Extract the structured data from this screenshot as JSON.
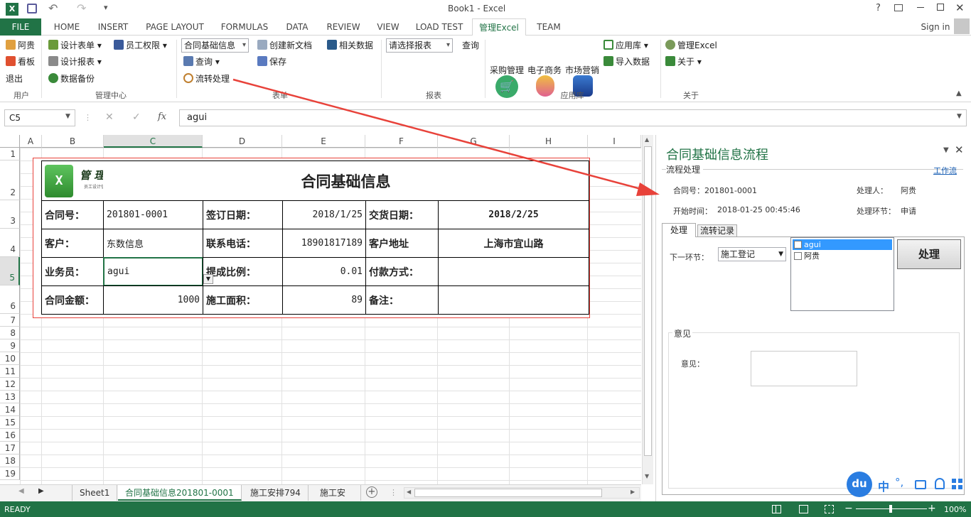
{
  "window": {
    "title": "Book1 - Excel",
    "help": "?",
    "signin": "Sign in"
  },
  "ribbon_tabs": [
    "FILE",
    "HOME",
    "INSERT",
    "PAGE LAYOUT",
    "FORMULAS",
    "DATA",
    "REVIEW",
    "VIEW",
    "LOAD TEST",
    "管理Excel",
    "TEAM"
  ],
  "ribbon": {
    "user": {
      "name": "阿贵",
      "dashboard": "看板",
      "logout": "退出",
      "group": "用户"
    },
    "admin": {
      "design_form": "设计表单",
      "design_report": "设计报表",
      "backup": "数据备份",
      "staff_perm": "员工权限",
      "group": "管理中心"
    },
    "form": {
      "combo": "合同基础信息",
      "query": "查询",
      "flow": "流转处理",
      "new_doc": "创建新文档",
      "save": "保存",
      "related": "相关数据",
      "group": "表单"
    },
    "report": {
      "combo": "请选择报表",
      "query": "查询",
      "group": "报表"
    },
    "apps": {
      "purchase": "采购管理",
      "ecommerce": "电子商务",
      "marketing": "市场营销",
      "app_store": "应用库",
      "import": "导入数据",
      "group": "应用库"
    },
    "about": {
      "manage": "管理Excel",
      "about": "关于",
      "group": "关于"
    }
  },
  "formula_bar": {
    "name_box": "C5",
    "fx": "fx",
    "value": "agui"
  },
  "columns": [
    "A",
    "B",
    "C",
    "D",
    "E",
    "F",
    "G",
    "H",
    "I"
  ],
  "rows": [
    "1",
    "2",
    "3",
    "4",
    "5",
    "6",
    "7",
    "8",
    "9",
    "10",
    "11",
    "12",
    "13",
    "14",
    "15",
    "16",
    "17",
    "18",
    "19"
  ],
  "form": {
    "logo_text": "管 理 Excel",
    "logo_sub": "员工设计信息化系统",
    "title": "合同基础信息",
    "r3": [
      "合同号：",
      "201801-0001",
      "签订日期：",
      "2018/1/25",
      "交货日期：",
      "2018/2/25"
    ],
    "r4": [
      "客户：",
      "东数信息",
      "联系电话：",
      "18901817189",
      "客户地址",
      "上海市宜山路"
    ],
    "r5": [
      "业务员：",
      "agui",
      "提成比例：",
      "0.01",
      "付款方式：",
      ""
    ],
    "r6": [
      "合同金额：",
      "1000",
      "施工面积：",
      "89",
      "备注：",
      ""
    ]
  },
  "sheet_tabs": [
    "Sheet1",
    "合同基础信息201801-0001",
    "施工安排794",
    "施工安"
  ],
  "status": {
    "ready": "READY",
    "zoom": "100%"
  },
  "pane": {
    "title": "合同基础信息流程",
    "section": "流程处理",
    "workflow_link": "工作流",
    "contract_no": "合同号：201801-0001",
    "handler_label": "处理人：",
    "handler": "阿贵",
    "start_label": "开始时间：",
    "start_time": "2018-01-25 00:45:46",
    "stage_label": "处理环节：",
    "stage": "申请",
    "tab_process": "处理",
    "tab_history": "流转记录",
    "next_label": "下一环节：",
    "next_value": "施工登记",
    "assignees": [
      "agui",
      "阿贵"
    ],
    "process_button": "处理",
    "opinion_group": "意见",
    "opinion_label": "意见："
  },
  "ime": {
    "badge": "du",
    "lang": "中"
  },
  "colors": {
    "accent": "#217346",
    "arrow": "#e8423a",
    "form_border": "#e8423a"
  }
}
